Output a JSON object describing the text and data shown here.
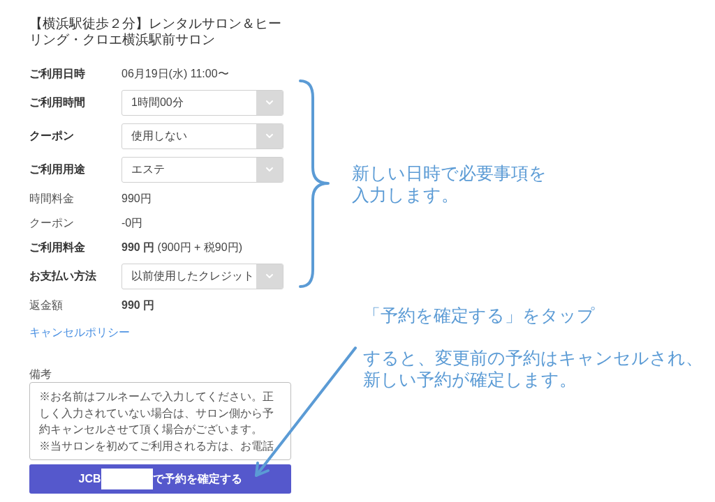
{
  "venue_title": "【横浜駅徒歩２分】レンタルサロン＆ヒーリング・クロエ横浜駅前サロン",
  "details": [
    {
      "kind": "info",
      "label": "ご利用日時",
      "value": "06月19日(水) 11:00〜"
    },
    {
      "kind": "select",
      "label": "ご利用時間",
      "value": "1時間00分"
    },
    {
      "kind": "select",
      "label": "クーポン",
      "value": "使用しない"
    },
    {
      "kind": "select",
      "label": "ご利用用途",
      "value": "エステ"
    },
    {
      "kind": "fee",
      "label": "時間料金",
      "value": "990円"
    },
    {
      "kind": "fee",
      "label": "クーポン",
      "value": "-0円"
    },
    {
      "kind": "total",
      "label": "ご利用料金",
      "value": "**990 円** (900円 + 税90円)"
    },
    {
      "kind": "select",
      "label": "お支払い方法",
      "value": "以前使用したクレジット"
    },
    {
      "kind": "refund",
      "label": "返金額",
      "value": "990 円"
    }
  ],
  "cancel_policy_link": "キャンセルポリシー",
  "notes": {
    "label": "備考",
    "value": "※お名前はフルネームで入力してください。正しく入力されていない場合は、サロン側から予約キャンセルさせて頂く場合がございます。\n※当サロンを初めてご利用される方は、お電話"
  },
  "confirm_button": {
    "label_before": "JCB",
    "redacted": true,
    "label_after": "で予約を確定する"
  },
  "annotations": [
    {
      "kind": "brace",
      "text": "新しい日時で必要事項を入力します。"
    },
    {
      "kind": "arrow",
      "title": "「予約を確定する」をタップ",
      "text": "すると、変更前の予約はキャンセルされ、新しい予約が確定します。"
    }
  ]
}
